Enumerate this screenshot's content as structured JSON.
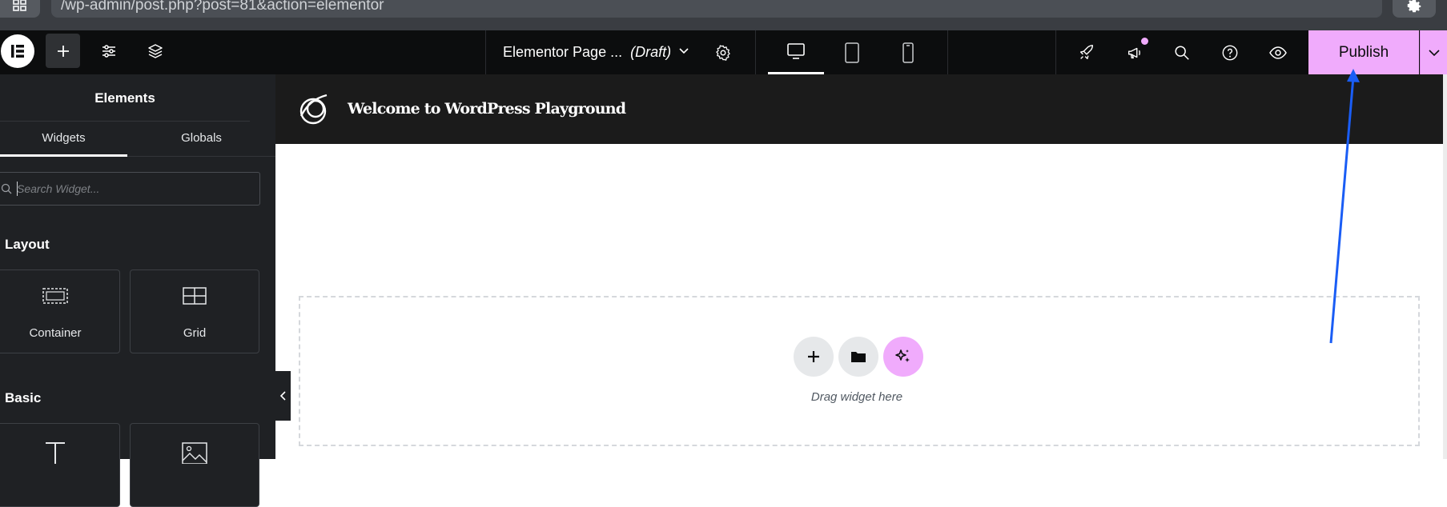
{
  "browser": {
    "url": "/wp-admin/post.php?post=81&action=elementor",
    "apps_icon": "grid-icon",
    "settings_icon": "gear-icon"
  },
  "topbar": {
    "page_title": "Elementor Page ...",
    "status": "(Draft)",
    "publish_label": "Publish",
    "left_tools": [
      "add-element-icon",
      "site-settings-icon",
      "structure-layers-icon"
    ],
    "devices": [
      "desktop",
      "tablet",
      "mobile"
    ],
    "active_device": "desktop",
    "right_tools": [
      "rocket-icon",
      "megaphone-icon",
      "search-icon",
      "help-icon",
      "preview-eye-icon"
    ]
  },
  "panel": {
    "title": "Elements",
    "tabs": [
      {
        "label": "Widgets",
        "active": true
      },
      {
        "label": "Globals",
        "active": false
      }
    ],
    "search_placeholder": "Search Widget...",
    "categories": [
      {
        "title": "Layout",
        "widgets": [
          {
            "label": "Container",
            "icon": "container-icon"
          },
          {
            "label": "Grid",
            "icon": "grid-layout-icon"
          }
        ]
      },
      {
        "title": "Basic",
        "widgets": [
          {
            "label": "",
            "icon": "heading-text-icon"
          },
          {
            "label": "",
            "icon": "image-icon"
          }
        ]
      }
    ]
  },
  "canvas": {
    "site_title": "Welcome to WordPress Playground",
    "drop_hint": "Drag widget here",
    "drop_buttons": [
      "add-section-icon",
      "template-library-icon",
      "ai-sparkle-icon"
    ]
  },
  "colors": {
    "accent": "#f0abfc",
    "topbar_bg": "#0c0d0e",
    "panel_bg": "#1f2124",
    "annotation_arrow": "#1a5df5"
  }
}
